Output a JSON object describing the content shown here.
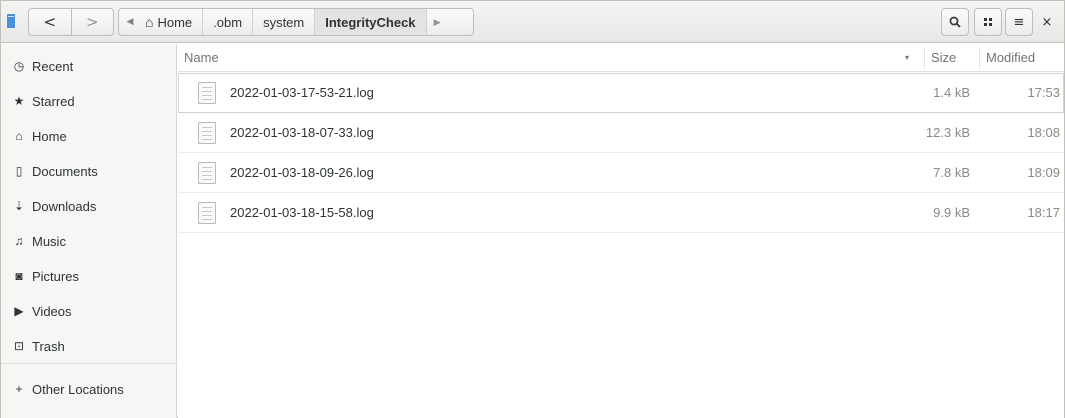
{
  "window": {
    "title": "IntegrityCheck"
  },
  "toolbar": {
    "app_icon": "files-app-icon",
    "back_icon": "chevron-left-icon",
    "back_glyph": "<",
    "forward_icon": "chevron-right-icon",
    "forward_glyph": ">",
    "path_scroll_left_glyph": "◀",
    "path_scroll_right_glyph": "▶",
    "home_glyph": "⌂",
    "breadcrumbs": [
      {
        "label": "Home",
        "icon": "home-icon"
      },
      {
        "label": ".obm"
      },
      {
        "label": "system"
      },
      {
        "label": "IntegrityCheck",
        "active": true
      }
    ],
    "search_glyph": "🔍",
    "view_grid_glyph": "⠿",
    "menu_glyph": "≡",
    "close_glyph": "×"
  },
  "sidebar": {
    "items": [
      {
        "label": "Recent",
        "icon": "clock-icon",
        "glyph": "◷"
      },
      {
        "label": "Starred",
        "icon": "star-icon",
        "glyph": "★"
      },
      {
        "label": "Home",
        "icon": "home-icon",
        "glyph": "⌂"
      },
      {
        "label": "Documents",
        "icon": "document-icon",
        "glyph": "▯"
      },
      {
        "label": "Downloads",
        "icon": "download-icon",
        "glyph": "⇣"
      },
      {
        "label": "Music",
        "icon": "music-icon",
        "glyph": "♫"
      },
      {
        "label": "Pictures",
        "icon": "camera-icon",
        "glyph": "◙"
      },
      {
        "label": "Videos",
        "icon": "video-icon",
        "glyph": "▶"
      },
      {
        "label": "Trash",
        "icon": "trash-icon",
        "glyph": "⊡"
      }
    ],
    "other_locations": {
      "label": "Other Locations",
      "icon": "plus-icon",
      "glyph": "+"
    }
  },
  "file_list": {
    "columns": {
      "name": "Name",
      "size": "Size",
      "modified": "Modified",
      "sort_glyph": "▾"
    },
    "files": [
      {
        "name": "2022-01-03-17-53-21.log",
        "size": "1.4 kB",
        "modified": "17:53"
      },
      {
        "name": "2022-01-03-18-07-33.log",
        "size": "12.3 kB",
        "modified": "18:08"
      },
      {
        "name": "2022-01-03-18-09-26.log",
        "size": "7.8 kB",
        "modified": "18:09"
      },
      {
        "name": "2022-01-03-18-15-58.log",
        "size": "9.9 kB",
        "modified": "18:17"
      }
    ]
  },
  "colors": {
    "accent": "#4a90d9",
    "header_bg": "#e8e8e7",
    "sidebar_bg": "#f6f6f5",
    "muted_text": "#888a85"
  }
}
